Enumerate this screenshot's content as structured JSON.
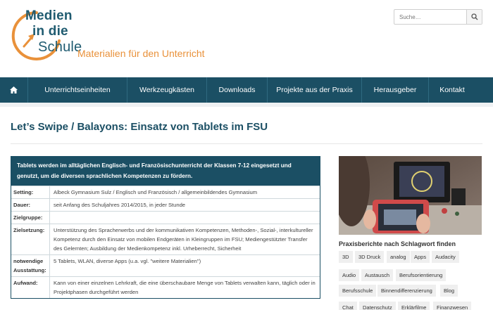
{
  "logo": {
    "line1": "Medien",
    "line2": "in die",
    "line3": "Schule",
    "tagline": "Materialien für den Unterricht"
  },
  "search": {
    "placeholder": "Suche…"
  },
  "nav": {
    "home_icon": "home-icon",
    "items": [
      "Unterrichtseinheiten",
      "Werkzeugkästen",
      "Downloads",
      "Projekte aus der Praxis",
      "Herausgeber",
      "Kontakt"
    ]
  },
  "page": {
    "title": "Let’s Swipe / Balayons: Einsatz von Tablets im FSU"
  },
  "info": {
    "heading": "Tablets werden im alltäglichen Englisch- und Französischunterricht der Klassen 7-12 eingesetzt und genutzt, um die diversen sprachlichen Kompetenzen zu fördern.",
    "rows": [
      {
        "key": "Setting:",
        "value": "Albeck Gymnasium Sulz / Englisch und Französisch / allgemeinbildendes Gymnasium"
      },
      {
        "key": "Dauer:",
        "value": "seit Anfang des Schuljahres 2014/2015, in jeder Stunde"
      },
      {
        "key": "Zielgruppe:",
        "value": ""
      },
      {
        "key": "Zielsetzung:",
        "value": "Unterstützung des Spracherwerbs und der kommunikativen Kompetenzen, Methoden-, Sozial-, interkultureller Kompetenz durch den Einsatz von mobilen Endgeräten in Kleingruppen im FSU; Mediengestützter Transfer des Gelernten; Ausbildung der Medienkompetenz inkl. Urheberrecht, Sicherheit"
      },
      {
        "key": "notwendige Ausstattung:",
        "value": "5 Tablets, WLAN, diverse Apps (u.a. vgl. \"weitere Materialien\")"
      },
      {
        "key": "Aufwand:",
        "value": "Kann von einer einzelnen Lehrkraft, die eine überschaubare Menge von Tablets verwalten kann, täglich oder in Projektphasen durchgeführt werden"
      }
    ]
  },
  "sidebar": {
    "tags_title": "Praxisberichte nach Schlagwort finden",
    "tags": [
      "3D",
      "3D Druck",
      "analog",
      "Apps",
      "Audacity",
      "Audio",
      "Austausch",
      "Berufsorientierung",
      "Berufsschule",
      "Binnendifferenzierung",
      "Blog",
      "Chat",
      "Datenschutz",
      "Erklärfilme",
      "Finanzwesen"
    ]
  },
  "colors": {
    "brand_dark": "#1b4f64",
    "brand_orange": "#e9913a"
  }
}
